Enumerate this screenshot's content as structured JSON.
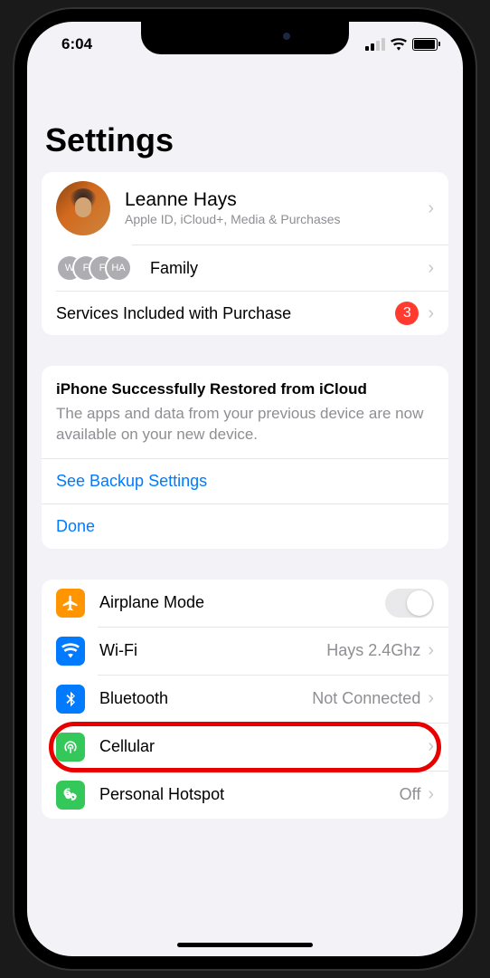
{
  "statusBar": {
    "time": "6:04"
  },
  "page": {
    "title": "Settings"
  },
  "profile": {
    "name": "Leanne Hays",
    "subtitle": "Apple ID, iCloud+, Media & Purchases"
  },
  "family": {
    "label": "Family",
    "initials": [
      "W",
      "F",
      "F",
      "HA"
    ]
  },
  "services": {
    "label": "Services Included with Purchase",
    "badge": "3"
  },
  "restore": {
    "title": "iPhone Successfully Restored from iCloud",
    "body": "The apps and data from your previous device are now available on your new device.",
    "link1": "See Backup Settings",
    "link2": "Done"
  },
  "connectivity": {
    "airplane": {
      "label": "Airplane Mode",
      "enabled": false
    },
    "wifi": {
      "label": "Wi-Fi",
      "value": "Hays 2.4Ghz"
    },
    "bluetooth": {
      "label": "Bluetooth",
      "value": "Not Connected"
    },
    "cellular": {
      "label": "Cellular"
    },
    "hotspot": {
      "label": "Personal Hotspot",
      "value": "Off"
    }
  },
  "annotation": {
    "highlighted_row": "cellular"
  }
}
